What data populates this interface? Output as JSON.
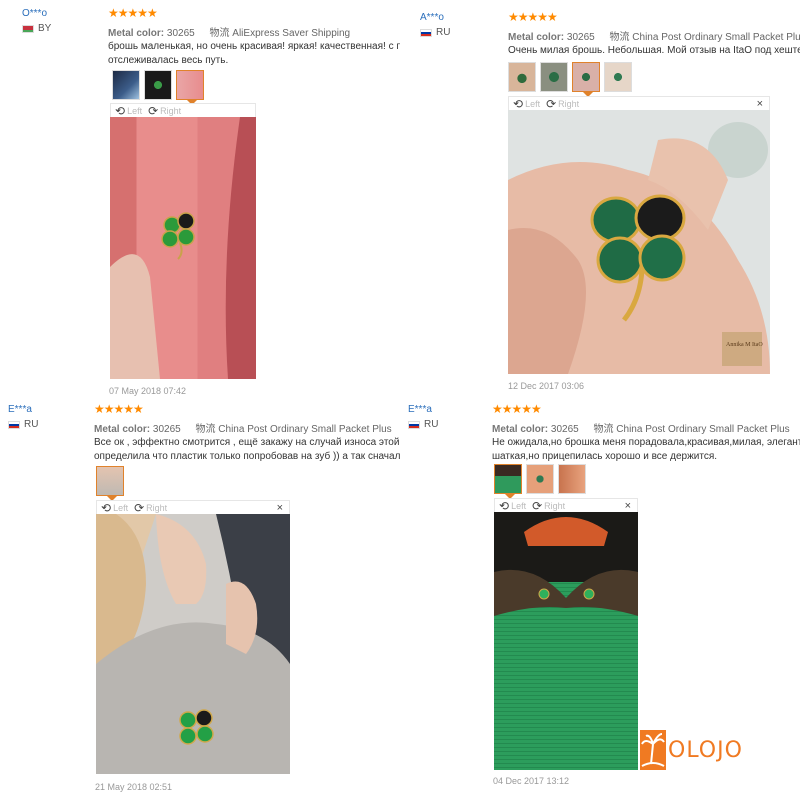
{
  "reviews": [
    {
      "username": "O***o",
      "country": "BY",
      "stars": "★★★★★",
      "metal_label": "Metal color:",
      "metal_value": "30265",
      "shipping_label": "物流",
      "shipping_value": "AliExpress Saver Shipping",
      "text_line1": "брошь маленькая, но очень красивая! яркая! качественная! с прод",
      "text_line2": "отслеживалась весь путь.",
      "date": "07 May 2018 07:42"
    },
    {
      "username": "A***o",
      "country": "RU",
      "stars": "★★★★★",
      "metal_label": "Metal color:",
      "metal_value": "30265",
      "shipping_label": "物流",
      "shipping_value": "China Post Ordinary Small Packet Plus",
      "text_line1": "Очень милая брошь. Небольшая. Мой отзыв на ItaO под хештегом",
      "text_line2": "",
      "date": "12 Dec 2017 03:06",
      "watermark": "Annika M ItaO"
    },
    {
      "username": "E***a",
      "country": "RU",
      "stars": "★★★★★",
      "metal_label": "Metal color:",
      "metal_value": "30265",
      "shipping_label": "物流",
      "shipping_value": "China Post Ordinary Small Packet Plus",
      "text_line1": "Все ок , эффектно смотрится , ещё закажу на случай износа этой брош",
      "text_line2": "определила что пластик только попробовав на зуб )) а так сначала по",
      "date": "21 May 2018 02:51"
    },
    {
      "username": "E***a",
      "country": "RU",
      "stars": "★★★★★",
      "metal_label": "Metal color:",
      "metal_value": "30265",
      "shipping_label": "物流",
      "shipping_value": "China Post Ordinary Small Packet Plus",
      "text_line1": "Не ожидала,но брошка меня порадовала,красивая,милая, элегантная)С",
      "text_line2": "шаткая,но прицепилась хорошо и все держится.",
      "date": "04 Dec 2017 13:12"
    }
  ],
  "viewer": {
    "left_label": "Left",
    "right_label": "Right",
    "close_label": "×",
    "rotate_left_icon": "rotate-left-icon",
    "rotate_right_icon": "rotate-right-icon"
  },
  "logo": {
    "text": "OLOJO",
    "icon": "palm-tree-icon"
  },
  "colors": {
    "star": "#ff8a00",
    "username": "#2a6ebb",
    "accent": "#e0822b",
    "logo": "#f07a22"
  }
}
